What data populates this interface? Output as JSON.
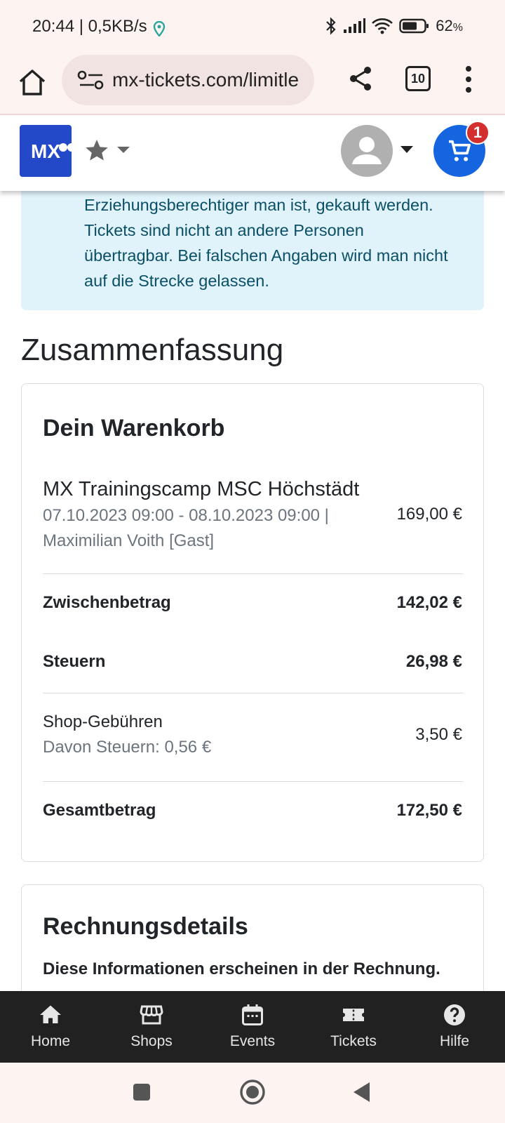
{
  "status_bar": {
    "time_speed": "20:44 | 0,5KB/s",
    "battery": "62",
    "battery_unit": "%"
  },
  "browser": {
    "url": "mx-tickets.com/limitle",
    "tab_count": "10"
  },
  "header": {
    "logo_text": "MX",
    "cart_count": "1"
  },
  "info": {
    "text": "Erziehungsberechtiger man ist, gekauft werden. Tickets sind nicht an andere Personen übertragbar. Bei falschen Angaben wird man nicht auf die Strecke gelassen."
  },
  "summary": {
    "title": "Zusammenfassung",
    "cart_title": "Dein Warenkorb",
    "item": {
      "name": "MX Trainingscamp MSC Höchstädt",
      "dates": "07.10.2023 09:00 - 08.10.2023 09:00 |",
      "person": "Maximilian Voith [Gast]",
      "price": "169,00 €"
    },
    "subtotal_label": "Zwischenbetrag",
    "subtotal_value": "142,02 €",
    "tax_label": "Steuern",
    "tax_value": "26,98 €",
    "fees_label": "Shop-Gebühren",
    "fees_sub": "Davon Steuern: 0,56 €",
    "fees_value": "3,50 €",
    "total_label": "Gesamtbetrag",
    "total_value": "172,50 €"
  },
  "billing": {
    "title": "Rechnungsdetails",
    "desc": "Diese Informationen erscheinen in der Rechnung."
  },
  "bottom_nav": [
    {
      "label": "Home",
      "icon": "home-icon"
    },
    {
      "label": "Shops",
      "icon": "store-icon"
    },
    {
      "label": "Events",
      "icon": "calendar-icon"
    },
    {
      "label": "Tickets",
      "icon": "ticket-icon"
    },
    {
      "label": "Hilfe",
      "icon": "help-icon"
    }
  ],
  "colors": {
    "brand_blue": "#1565e0",
    "logo_blue": "#2348c8",
    "info_bg": "#e0f3fb",
    "info_text": "#0b4f66",
    "badge_red": "#d32f2f",
    "nav_bg": "#212121"
  }
}
